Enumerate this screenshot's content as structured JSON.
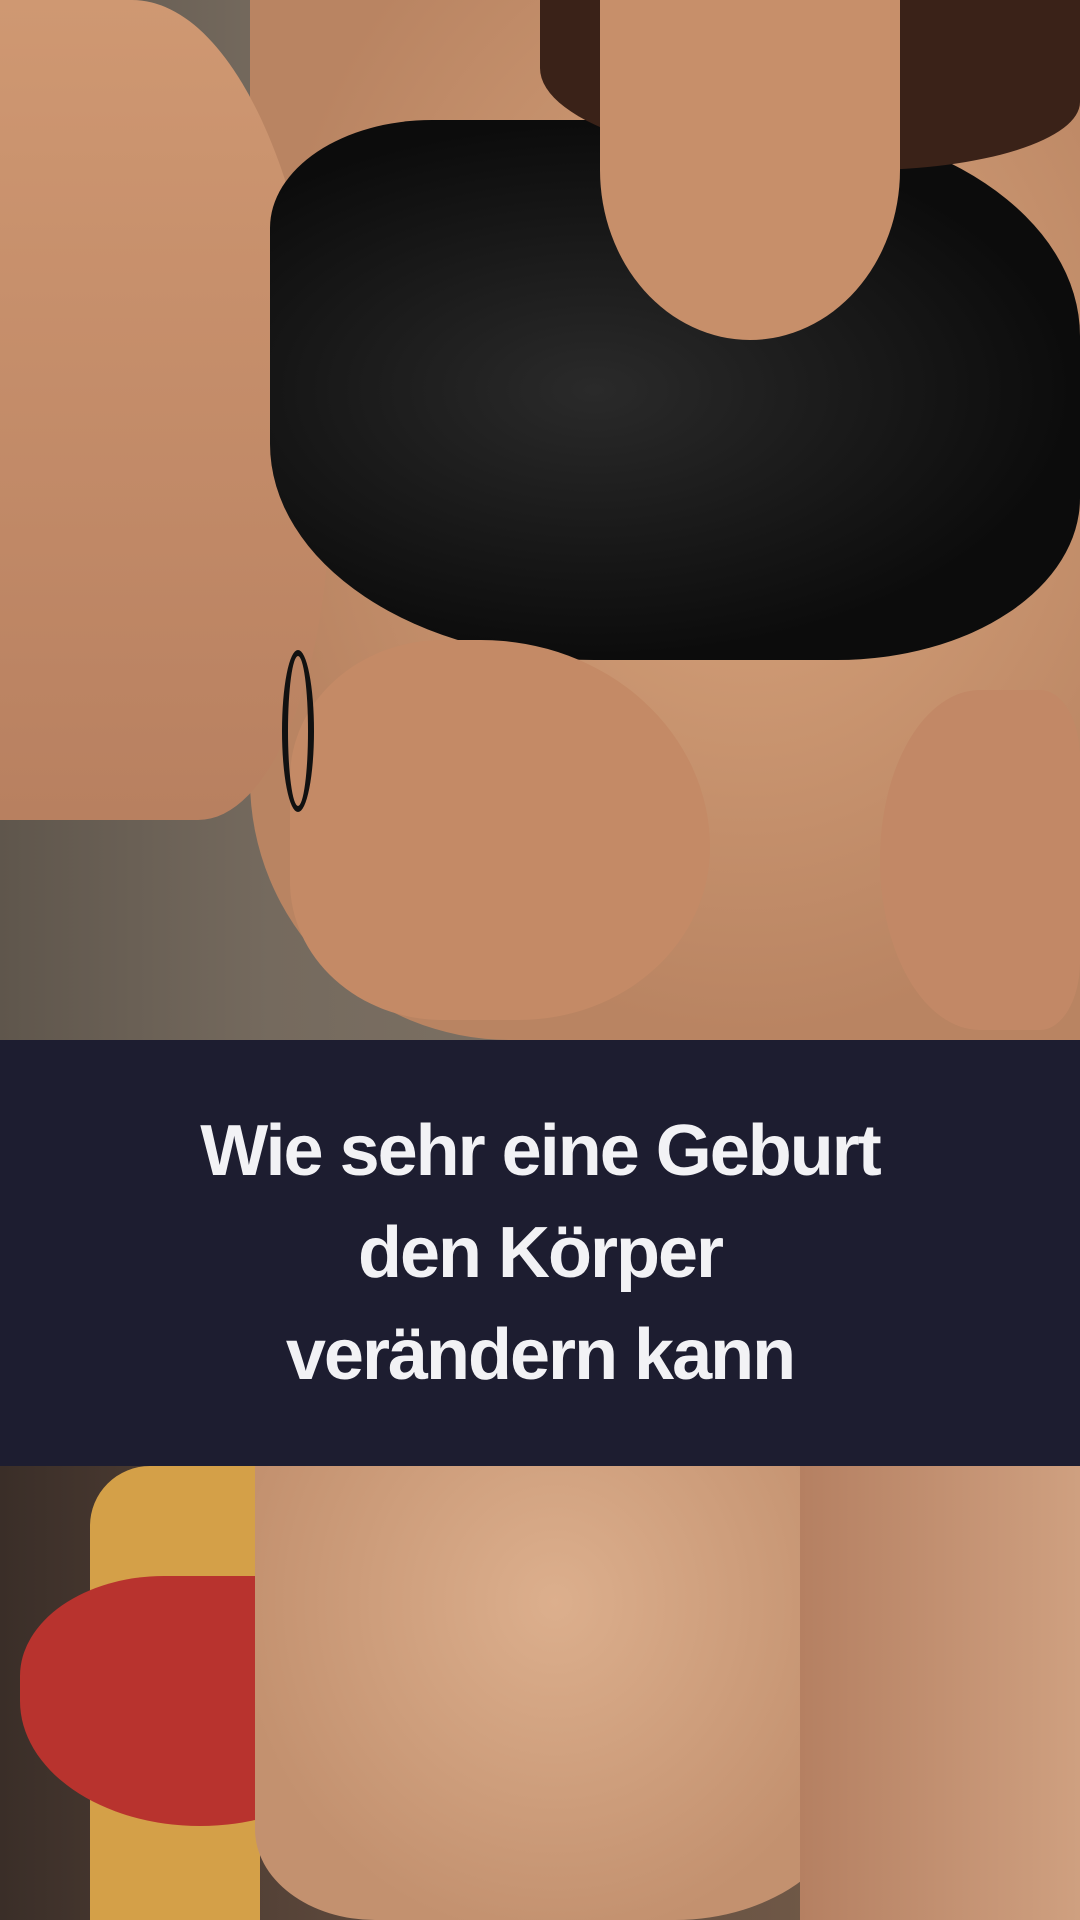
{
  "headline": {
    "lines": [
      "Wie sehr eine Geburt",
      "den Körper",
      "verändern kann"
    ]
  },
  "colors": {
    "banner_background": "#1d1d30",
    "headline_text": "#f2f2f5"
  }
}
